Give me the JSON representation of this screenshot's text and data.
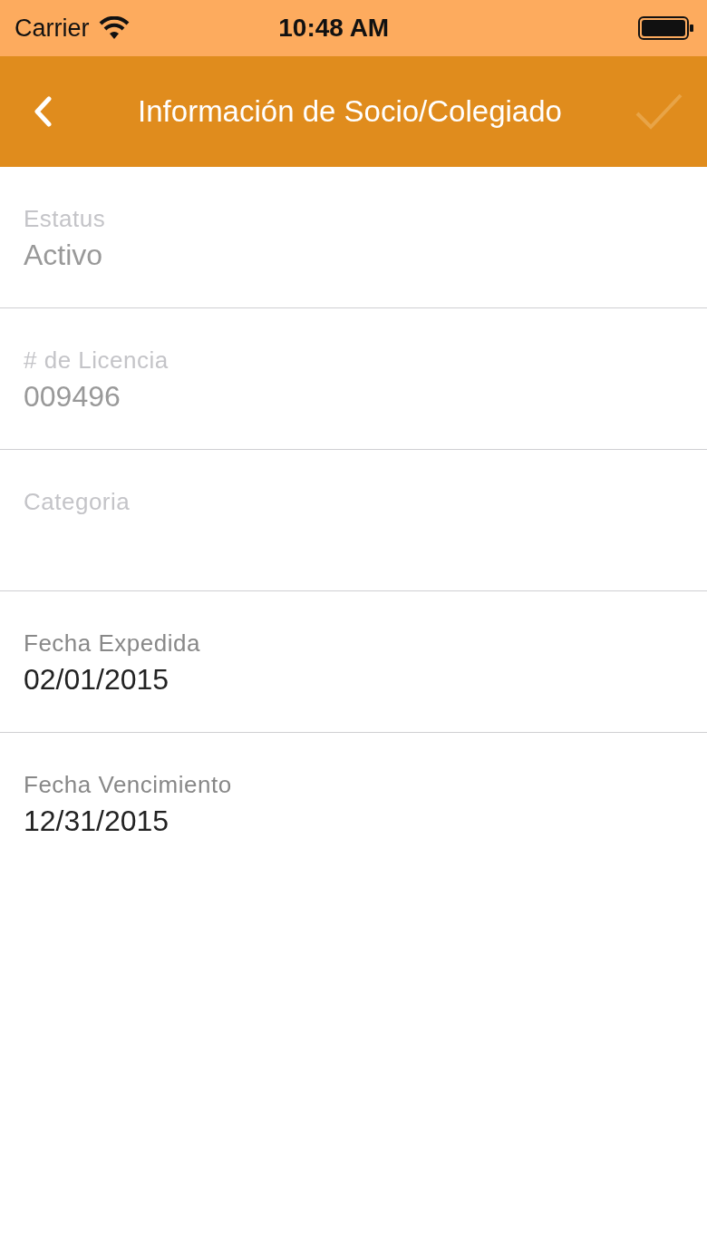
{
  "status_bar": {
    "carrier": "Carrier",
    "time": "10:48 AM"
  },
  "nav_bar": {
    "title": "Información de Socio/Colegiado",
    "done_disabled": true
  },
  "fields": [
    {
      "label": "Estatus",
      "value": "Activo",
      "disabled": true
    },
    {
      "label": "# de Licencia",
      "value": "009496",
      "disabled": true
    },
    {
      "label": "Categoria",
      "disabled": true
    },
    {
      "label": "Fecha Expedida",
      "value": "02/01/2015",
      "disabled": false
    },
    {
      "label": "Fecha Vencimiento",
      "value": "12/31/2015",
      "disabled": false
    }
  ]
}
